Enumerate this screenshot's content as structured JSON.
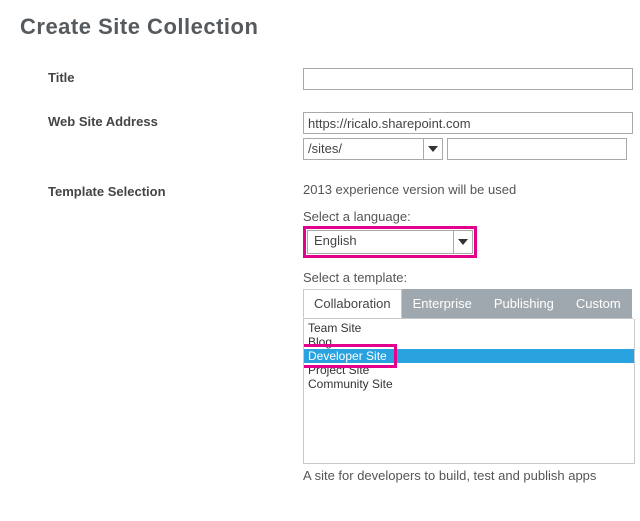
{
  "page_title": "Create Site Collection",
  "labels": {
    "title": "Title",
    "address": "Web Site Address",
    "template": "Template Selection"
  },
  "address": {
    "host": "https://ricalo.sharepoint.com",
    "path_selected": "/sites/",
    "name": ""
  },
  "template_section": {
    "note": "2013 experience version will be used",
    "lang_label": "Select a language:",
    "lang_selected": "English",
    "tpl_label": "Select a template:",
    "tabs": [
      "Collaboration",
      "Enterprise",
      "Publishing",
      "Custom"
    ],
    "items": [
      "Team Site",
      "Blog",
      "Developer Site",
      "Project Site",
      "Community Site"
    ],
    "selected_index": 2,
    "description": "A site for developers to build, test and publish apps"
  }
}
